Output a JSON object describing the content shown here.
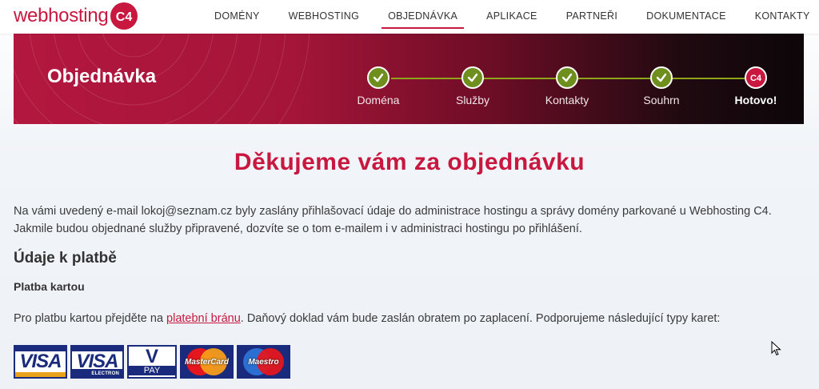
{
  "brand": {
    "logo_text": "webhosting",
    "badge_text": "C4"
  },
  "nav": {
    "items": [
      {
        "label": "DOMÉNY",
        "active": false
      },
      {
        "label": "WEBHOSTING",
        "active": false
      },
      {
        "label": "OBJEDNÁVKA",
        "active": true
      },
      {
        "label": "APLIKACE",
        "active": false
      },
      {
        "label": "PARTNEŘI",
        "active": false
      },
      {
        "label": "DOKUMENTACE",
        "active": false
      },
      {
        "label": "KONTAKTY",
        "active": false
      }
    ]
  },
  "banner": {
    "title": "Objednávka",
    "steps": [
      {
        "label": "Doména",
        "icon": "check-icon",
        "state": "done"
      },
      {
        "label": "Služby",
        "icon": "check-icon",
        "state": "done"
      },
      {
        "label": "Kontakty",
        "icon": "check-icon",
        "state": "done"
      },
      {
        "label": "Souhrn",
        "icon": "check-icon",
        "state": "done"
      },
      {
        "label": "Hotovo!",
        "icon": "c4-icon",
        "state": "current"
      }
    ]
  },
  "content": {
    "thanks": "Děkujeme vám za objednávku",
    "line1": "Na vámi uvedený e-mail lokoj@seznam.cz byly zaslány přihlašovací údaje do administrace hostingu a správy domény parkované u Webhosting C4.",
    "line2": "Jakmile budou objednané služby připravené, dozvíte se o tom e-mailem i v administraci hostingu po přihlášení.",
    "payment_heading": "Údaje k platbě",
    "card_heading": "Platba kartou",
    "pay_before": "Pro platbu kartou přejděte na ",
    "pay_link": "platební bránu",
    "pay_after": ". Daňový doklad vám bude zaslán obratem po zaplacení. Podporujeme následující typy karet:"
  },
  "cards": [
    {
      "name": "VISA",
      "sub": ""
    },
    {
      "name": "VISA",
      "sub": "ELECTRON"
    },
    {
      "name": "V",
      "sub": "PAY"
    },
    {
      "name": "MasterCard"
    },
    {
      "name": "Maestro"
    }
  ],
  "colors": {
    "accent": "#c8183f",
    "step_done": "#6e8f1e",
    "card_blue": "#1a2a7c"
  }
}
